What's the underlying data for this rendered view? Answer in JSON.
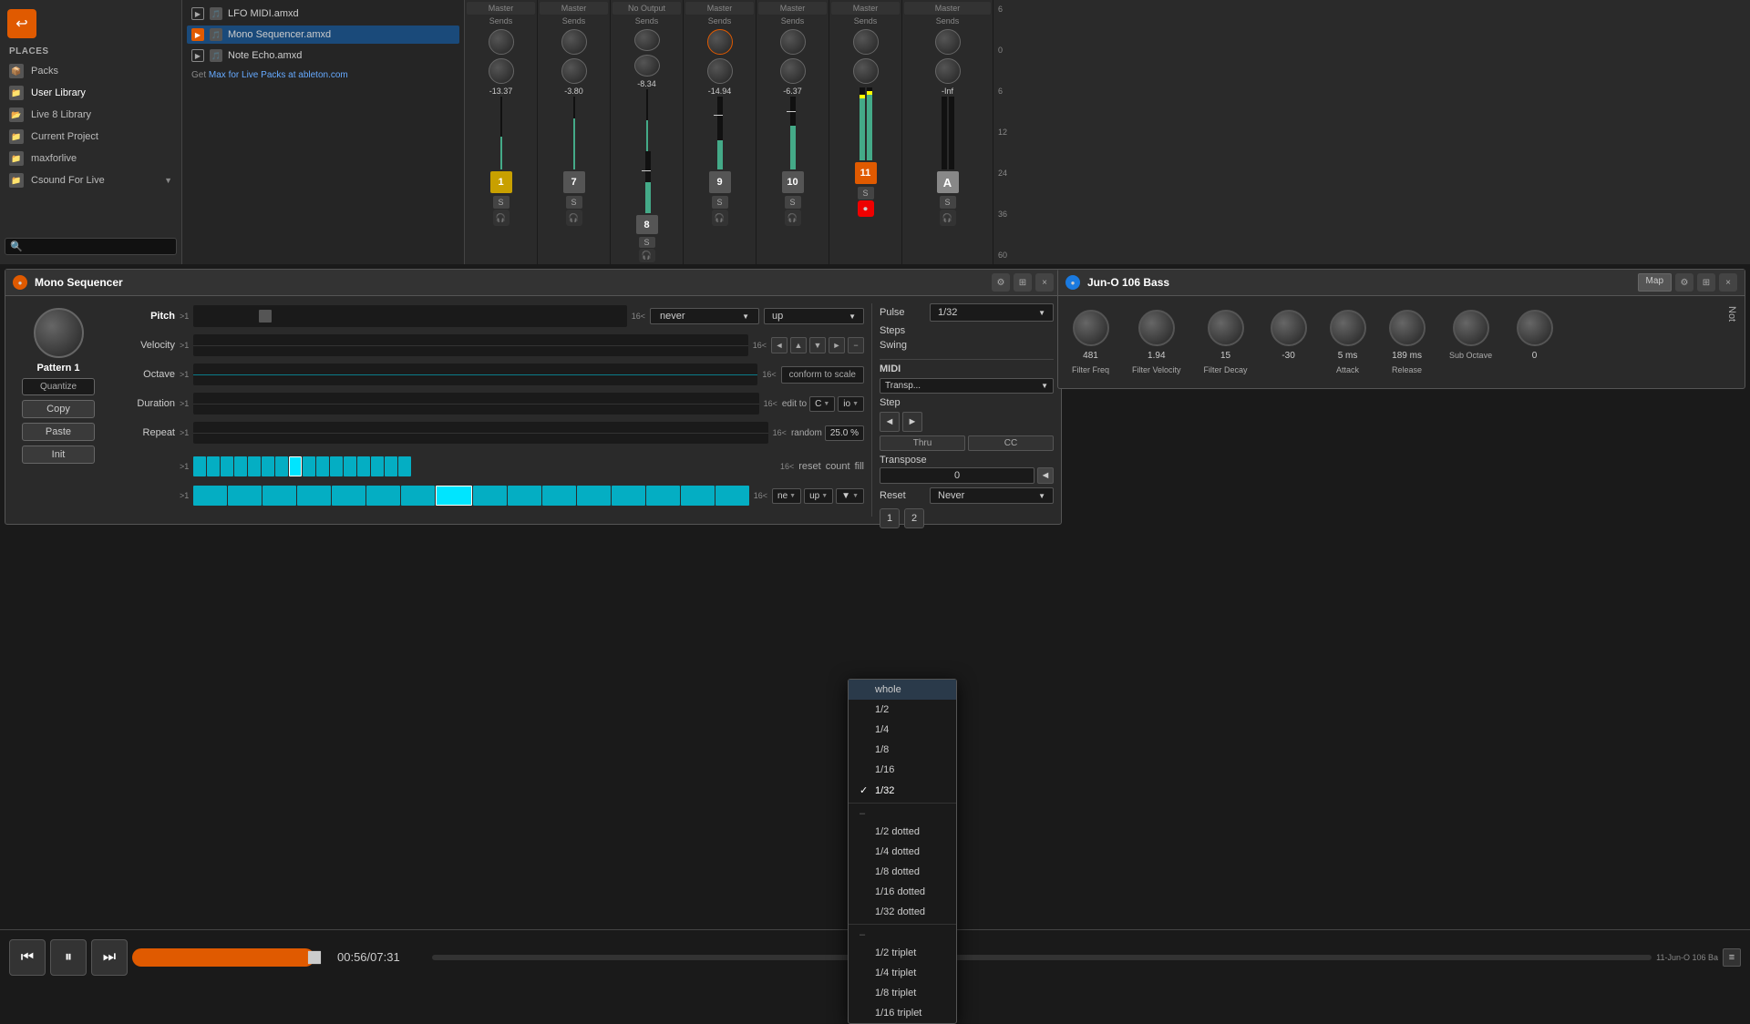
{
  "sidebar": {
    "places_header": "PLACES",
    "items": [
      {
        "label": "Packs",
        "icon": "📦"
      },
      {
        "label": "User Library",
        "icon": "📁"
      },
      {
        "label": "Live 8 Library",
        "icon": "📂"
      },
      {
        "label": "Current Project",
        "icon": "📁"
      },
      {
        "label": "maxforlive",
        "icon": "📁"
      },
      {
        "label": "Csound For Live",
        "icon": "📁"
      }
    ]
  },
  "file_browser": {
    "items": [
      {
        "label": "LFO MIDI.amxd",
        "type": "midi",
        "selected": false
      },
      {
        "label": "Mono Sequencer.amxd",
        "type": "midi",
        "selected": true
      },
      {
        "label": "Note Echo.amxd",
        "type": "midi",
        "selected": false
      }
    ],
    "get_packs_text": "Get",
    "get_packs_link": "Max for Live Packs at ableton.com"
  },
  "mixer": {
    "channels": [
      {
        "name": "Master",
        "num": "1",
        "num_style": "yellow",
        "db": "-13.37",
        "level_pct": 45,
        "s": true
      },
      {
        "name": "Master",
        "num": "7",
        "num_style": "gray",
        "db": "-3.80",
        "level_pct": 70,
        "s": true
      },
      {
        "name": "No Output",
        "num": "8",
        "num_style": "gray",
        "db": "-8.34",
        "level_pct": 50,
        "s": true
      },
      {
        "name": "Master",
        "num": "9",
        "num_style": "gray",
        "db": "-14.94",
        "level_pct": 40,
        "s": true
      },
      {
        "name": "Master",
        "num": "10",
        "num_style": "gray",
        "db": "-6.37",
        "level_pct": 60,
        "s": true
      },
      {
        "name": "Master",
        "num": "11",
        "num_style": "orange_bg",
        "db": "",
        "level_pct": 90,
        "s": true,
        "red": true
      },
      {
        "name": "Master",
        "num": "A",
        "num_style": "letter",
        "db": "-Inf",
        "level_pct": 0,
        "s": true
      }
    ]
  },
  "mono_sequencer": {
    "title": "Mono Sequencer",
    "pattern": "Pattern 1",
    "quantize_label": "Quantize",
    "copy_label": "Copy",
    "paste_label": "Paste",
    "init_label": "Init",
    "rows": [
      {
        "label": "Pitch",
        "active": true
      },
      {
        "label": "Velocity",
        "active": false
      },
      {
        "label": "Octave",
        "active": false
      },
      {
        "label": "Duration",
        "active": false
      },
      {
        "label": "Repeat",
        "active": false
      }
    ],
    "never_dropdown": "never",
    "up_dropdown": "up",
    "conform_btn": "conform to scale",
    "edit_to": "edit to",
    "edit_key": "C",
    "edit_mode": "io",
    "random_label": "random",
    "random_pct": "25.0 %",
    "range_start": ">1",
    "range_end": "16<",
    "pulse_label": "Pulse",
    "pulse_value": "1/32",
    "steps_label": "Steps",
    "swing_label": "Swing",
    "reset_label": "Reset",
    "reset_never": "Never",
    "reset_count": "reset",
    "count_label": "count",
    "fill_label": "fill",
    "midi_label": "MIDI",
    "num_1": "1",
    "num_2": "2",
    "ne_label": "ne",
    "bottom_range_start": ">1",
    "bottom_range_end": "16<"
  },
  "midi_panel": {
    "title": "MIDI",
    "transp_dropdown": "Transp...",
    "step_label": "Step",
    "thru_label": "Thru",
    "cc_label": "CC",
    "transpose_label": "Transpose",
    "transpose_val": "0",
    "nav_left": "◄",
    "nav_right": "►"
  },
  "pulse_menu": {
    "items": [
      {
        "label": "whole",
        "checked": false,
        "hovered": true
      },
      {
        "label": "1/2",
        "checked": false
      },
      {
        "label": "1/4",
        "checked": false
      },
      {
        "label": "1/8",
        "checked": false
      },
      {
        "label": "1/16",
        "checked": false
      },
      {
        "label": "1/32",
        "checked": true
      },
      {
        "label": "–",
        "divider": true
      },
      {
        "label": "1/2 dotted",
        "checked": false
      },
      {
        "label": "1/4 dotted",
        "checked": false
      },
      {
        "label": "1/8 dotted",
        "checked": false
      },
      {
        "label": "1/16 dotted",
        "checked": false
      },
      {
        "label": "1/32 dotted",
        "checked": false
      },
      {
        "label": "–",
        "divider": true
      },
      {
        "label": "1/2 triplet",
        "checked": false
      },
      {
        "label": "1/4 triplet",
        "checked": false
      },
      {
        "label": "1/8 triplet",
        "checked": false
      },
      {
        "label": "1/16 triplet",
        "checked": false
      }
    ]
  },
  "jun_o": {
    "title": "Jun-O 106 Bass",
    "map_btn": "Map",
    "not_label": "Not",
    "sections": [
      {
        "label": "Filter Freq",
        "val": "481"
      },
      {
        "label": "Filter Velocity",
        "val": "1.94"
      },
      {
        "label": "Filter Decay",
        "val": "15"
      },
      {
        "label": "",
        "val": "-30"
      },
      {
        "label": "Attack",
        "val": "5 ms"
      },
      {
        "label": "Release",
        "val": "189 ms"
      },
      {
        "label": "Sub Octave",
        "val": ""
      },
      {
        "label": "",
        "val": "0"
      }
    ]
  },
  "transport": {
    "time": "00:56/07:31",
    "date_label": "11-Jun-O 106 Ba"
  }
}
